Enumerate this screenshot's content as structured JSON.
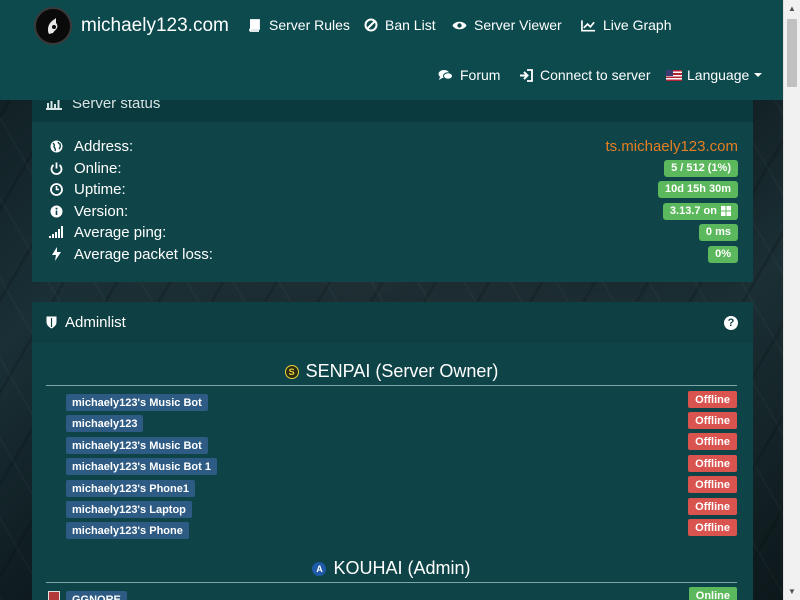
{
  "brand": {
    "title": "michaely123.com"
  },
  "nav": {
    "server_rules": "Server Rules",
    "ban_list": "Ban List",
    "server_viewer": "Server Viewer",
    "live_graph": "Live Graph",
    "forum": "Forum",
    "connect": "Connect to server",
    "language": "Language"
  },
  "status": {
    "title": "Server status",
    "rows": [
      {
        "label": "Address:",
        "value": "ts.michaely123.com"
      },
      {
        "label": "Online:",
        "value": "5 / 512 (1%)"
      },
      {
        "label": "Uptime:",
        "value": "10d 15h 30m"
      },
      {
        "label": "Version:",
        "value": "3.13.7 on"
      },
      {
        "label": "Average ping:",
        "value": "0 ms"
      },
      {
        "label": "Average packet loss:",
        "value": "0%"
      }
    ]
  },
  "adminlist": {
    "title": "Adminlist",
    "help": "?",
    "groups": [
      {
        "name": "SENPAI (Server Owner)",
        "badge": "S",
        "members": [
          {
            "name": "michaely123's Music Bot",
            "status": "Offline"
          },
          {
            "name": "michaely123",
            "status": "Offline"
          },
          {
            "name": "michaely123's Music Bot",
            "status": "Offline"
          },
          {
            "name": "michaely123's Music Bot 1",
            "status": "Offline"
          },
          {
            "name": "michaely123's Phone1",
            "status": "Offline"
          },
          {
            "name": "michaely123's Laptop",
            "status": "Offline"
          },
          {
            "name": "michaely123's Phone",
            "status": "Offline"
          }
        ]
      },
      {
        "name": "KOUHAI (Admin)",
        "badge": "A",
        "members": [
          {
            "name": "GGNORE",
            "status": "Online"
          }
        ]
      }
    ]
  },
  "colors": {
    "navbar": "#0c4a4d",
    "panel": "#0e4347",
    "accent_address": "#e67e22",
    "success": "#5cb85c",
    "danger": "#d9534f",
    "member_badge": "#2e5b83"
  }
}
